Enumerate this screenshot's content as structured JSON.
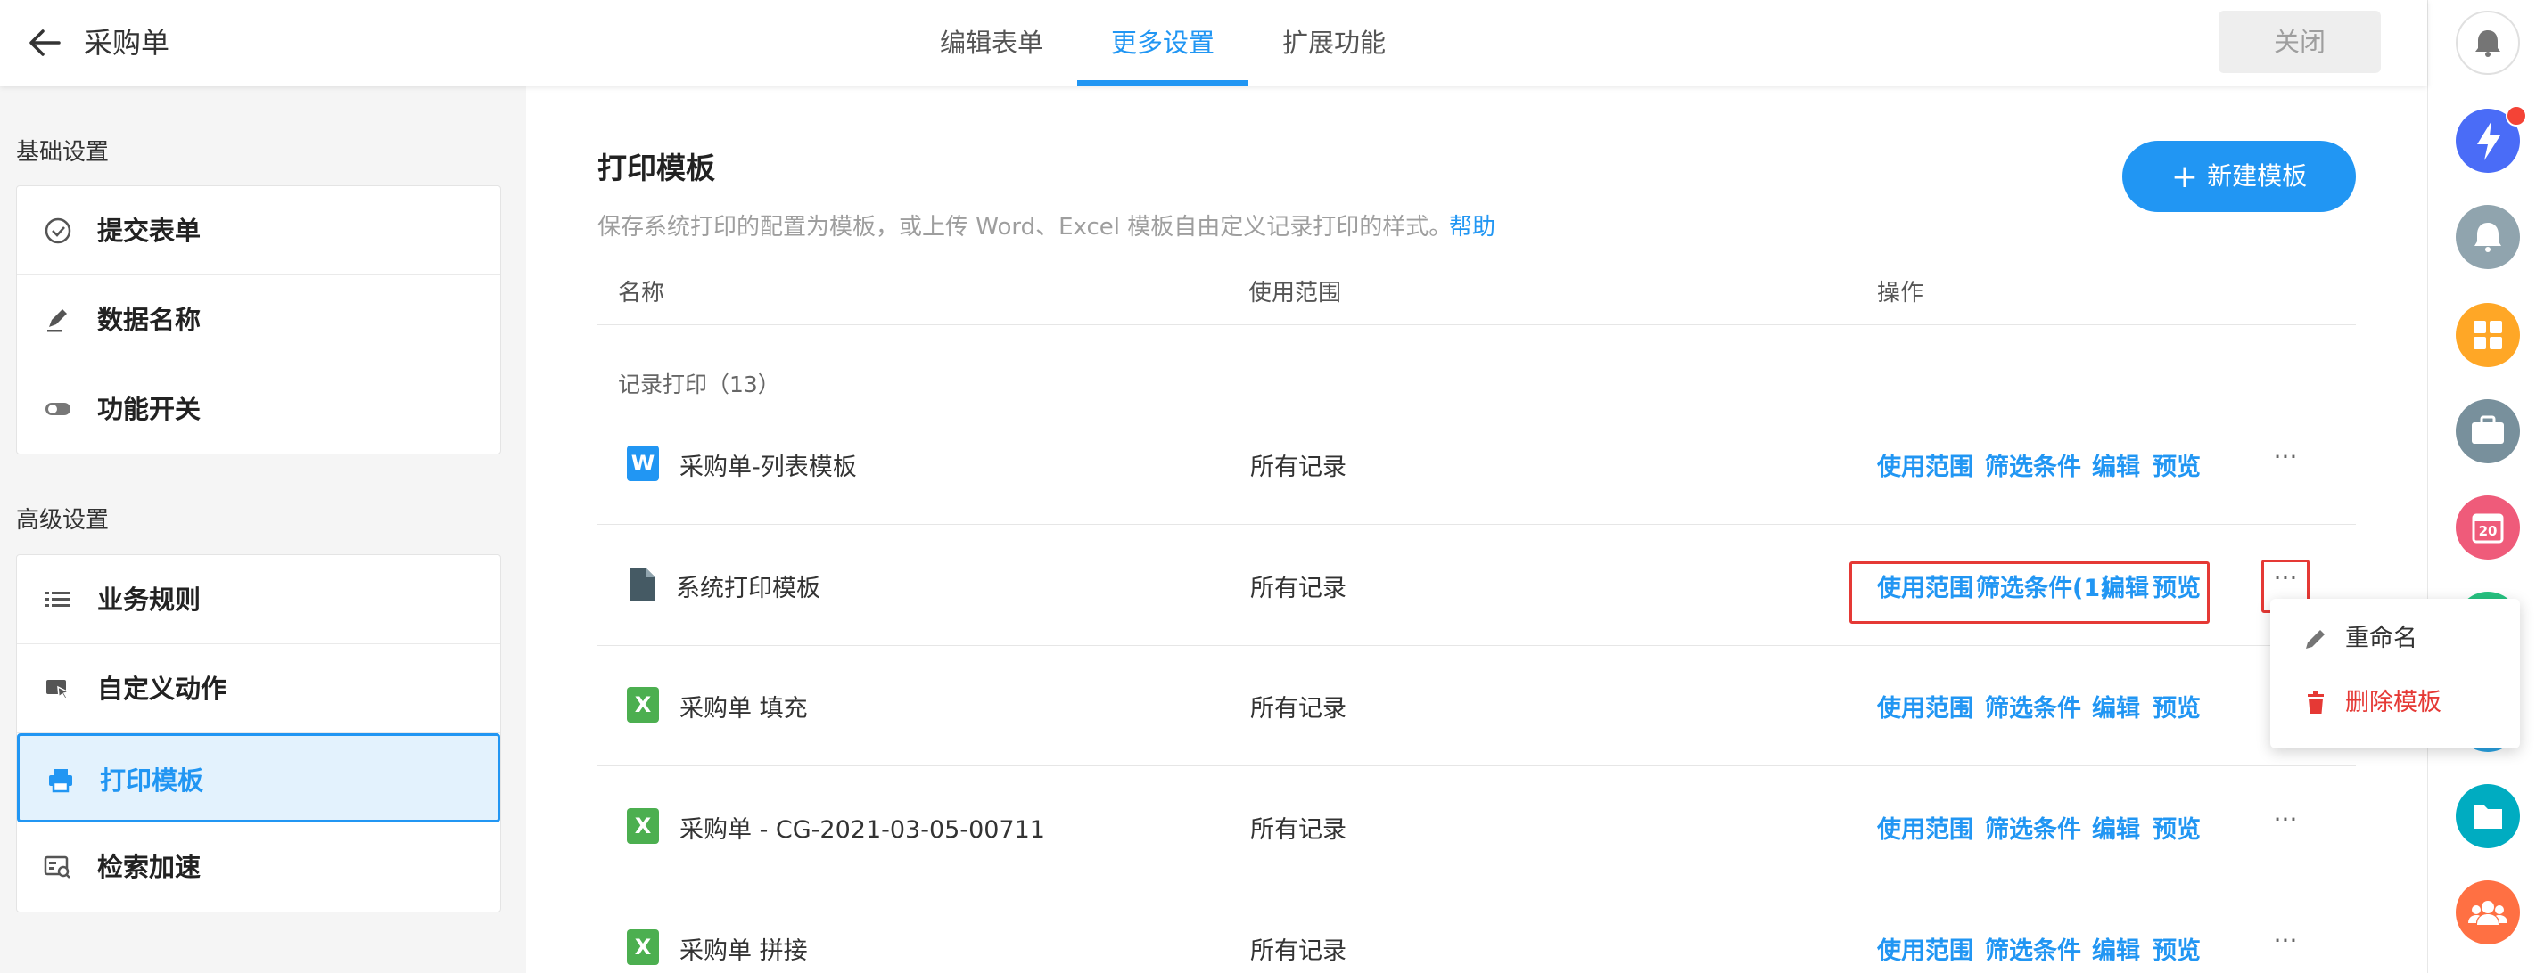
{
  "header": {
    "title": "采购单",
    "tabs": [
      {
        "label": "编辑表单",
        "active": false
      },
      {
        "label": "更多设置",
        "active": true
      },
      {
        "label": "扩展功能",
        "active": false
      }
    ],
    "close_label": "关闭"
  },
  "sidebar": {
    "basic_title": "基础设置",
    "basic_items": [
      {
        "label": "提交表单",
        "icon": "check-circle-icon"
      },
      {
        "label": "数据名称",
        "icon": "pen-icon"
      },
      {
        "label": "功能开关",
        "icon": "toggle-icon"
      }
    ],
    "advanced_title": "高级设置",
    "advanced_items": [
      {
        "label": "业务规则",
        "icon": "list-icon"
      },
      {
        "label": "自定义动作",
        "icon": "custom-action-icon"
      },
      {
        "label": "打印模板",
        "icon": "printer-icon",
        "active": true
      },
      {
        "label": "检索加速",
        "icon": "search-speed-icon"
      }
    ]
  },
  "main": {
    "title": "打印模板",
    "description": "保存系统打印的配置为模板，或上传 Word、Excel 模板自由定义记录打印的样式。",
    "help_label": "帮助",
    "new_button_label": "新建模板",
    "columns": [
      "名称",
      "使用范围",
      "操作"
    ],
    "group_label": "记录打印（13）",
    "rows": [
      {
        "icon_letter": "W",
        "file_type": "word",
        "name": "采购单-列表模板",
        "scope": "所有记录",
        "ops": [
          "使用范围",
          "筛选条件",
          "编辑",
          "预览"
        ]
      },
      {
        "icon_letter": "",
        "file_type": "system",
        "name": "系统打印模板",
        "scope": "所有记录",
        "ops": [
          "使用范围",
          "筛选条件(1)",
          "编辑",
          "预览"
        ]
      },
      {
        "icon_letter": "X",
        "file_type": "excel",
        "name": "采购单 填充",
        "scope": "所有记录",
        "ops": [
          "使用范围",
          "筛选条件",
          "编辑",
          "预览"
        ]
      },
      {
        "icon_letter": "X",
        "file_type": "excel",
        "name": "采购单 - CG-2021-03-05-00711",
        "scope": "所有记录",
        "ops": [
          "使用范围",
          "筛选条件",
          "编辑",
          "预览"
        ]
      },
      {
        "icon_letter": "X",
        "file_type": "excel",
        "name": "采购单 拼接",
        "scope": "所有记录",
        "ops": [
          "使用范围",
          "筛选条件",
          "编辑",
          "预览"
        ]
      }
    ],
    "more_glyph": "···"
  },
  "dropdown": {
    "items": [
      {
        "label": "重命名",
        "icon": "pencil-icon"
      },
      {
        "label": "删除模板",
        "icon": "trash-icon",
        "color": "#e53935"
      }
    ]
  },
  "rail": {
    "calendar_day": "20",
    "buttons": [
      {
        "icon": "bell-icon",
        "color": "#ffffff"
      },
      {
        "icon": "ai-assistant-icon",
        "color": "#4a6cf7"
      },
      {
        "icon": "notification-icon",
        "color": "#90a4ae"
      },
      {
        "icon": "apps-icon",
        "color": "#ffa726"
      },
      {
        "icon": "briefcase-icon",
        "color": "#78909c"
      },
      {
        "icon": "calendar-icon",
        "color": "#ef5b7a"
      },
      {
        "icon": "chat-icon",
        "color": "#26c281"
      },
      {
        "icon": "globe-icon",
        "color": "#29a3e3"
      },
      {
        "icon": "folder-icon",
        "color": "#00acc1"
      },
      {
        "icon": "team-icon",
        "color": "#ff7043"
      }
    ]
  },
  "colors": {
    "accent": "#2196f3",
    "danger": "#e53935",
    "excel": "#4caf50",
    "word": "#2196f3"
  }
}
